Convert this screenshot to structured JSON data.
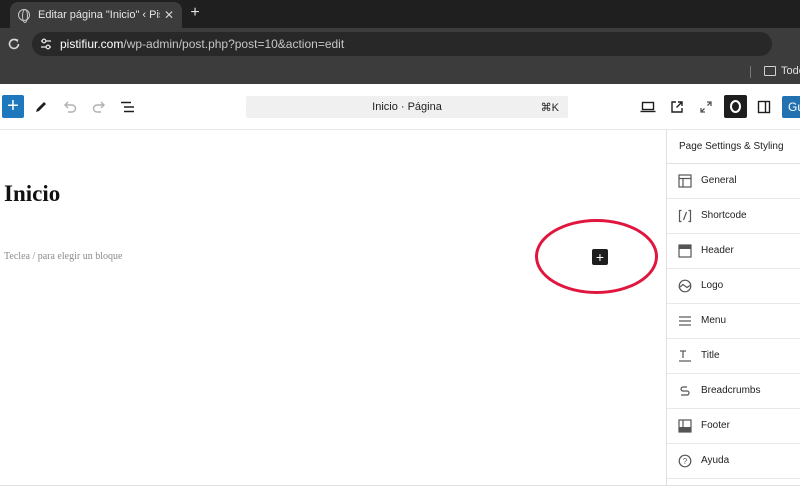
{
  "browser": {
    "tab_title": "Editar página \"Inicio\" ‹ Pistifiur",
    "tab_close": "✕",
    "new_tab": "+",
    "url_host": "pistifiur.com",
    "url_path": "/wp-admin/post.php?post=10&action=edit",
    "bookmark_folder": "Todo"
  },
  "toolbar": {
    "inserter_label": "+",
    "document_title": "Inicio · Página",
    "command_shortcut": "⌘K",
    "save_label": "Gu"
  },
  "canvas": {
    "post_title": "Inicio",
    "block_placeholder": "Teclea / para elegir un bloque",
    "add_block": "+"
  },
  "sidebar": {
    "title": "Page Settings & Styling",
    "items": [
      {
        "label": "General",
        "icon": "layout-icon"
      },
      {
        "label": "Shortcode",
        "icon": "shortcode-icon"
      },
      {
        "label": "Header",
        "icon": "header-icon"
      },
      {
        "label": "Logo",
        "icon": "logo-icon"
      },
      {
        "label": "Menu",
        "icon": "menu-icon"
      },
      {
        "label": "Title",
        "icon": "title-icon"
      },
      {
        "label": "Breadcrumbs",
        "icon": "breadcrumbs-icon"
      },
      {
        "label": "Footer",
        "icon": "footer-icon"
      },
      {
        "label": "Ayuda",
        "icon": "help-icon"
      }
    ]
  },
  "colors": {
    "wp_blue": "#1e78be",
    "annotation": "#e0163f",
    "chrome_dark": "#1f1f1f"
  }
}
